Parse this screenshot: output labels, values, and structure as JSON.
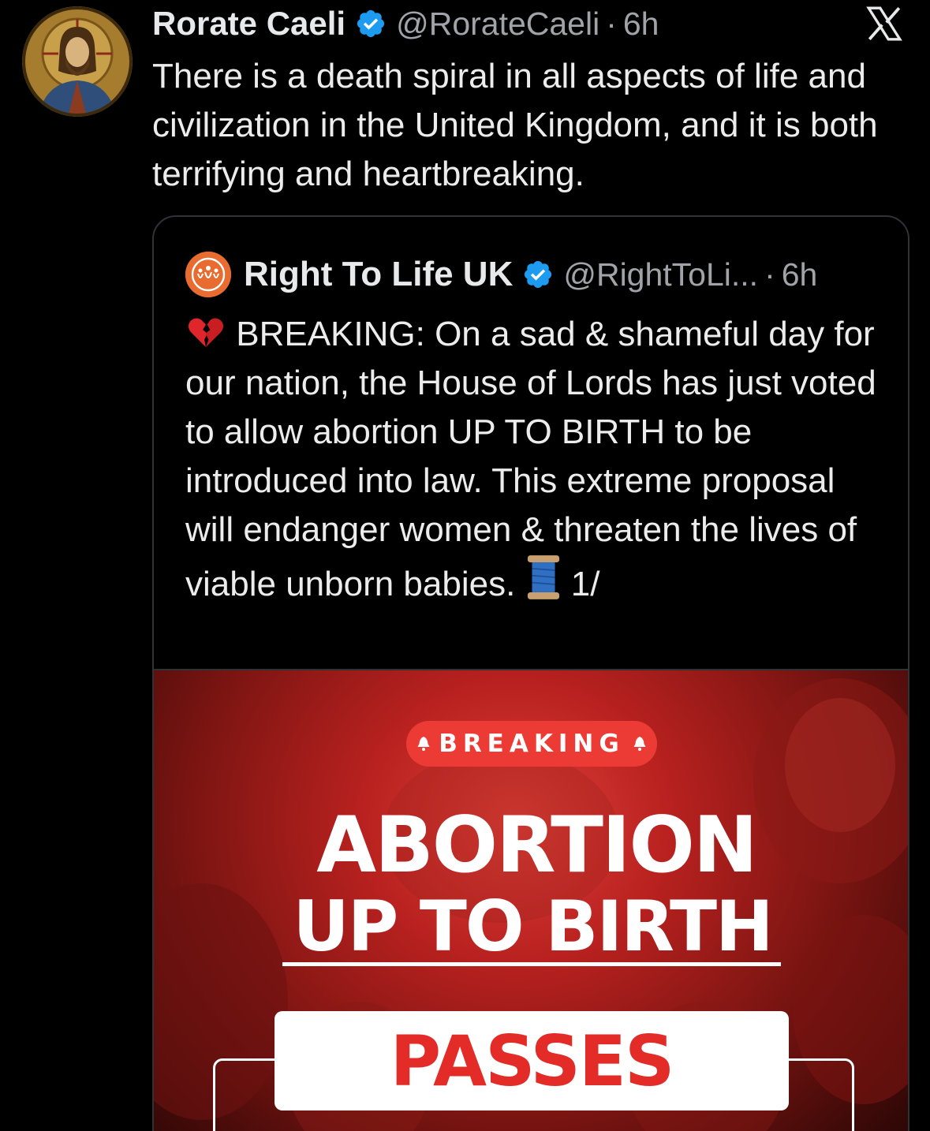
{
  "tweet": {
    "author_name": "Rorate Caeli",
    "handle": "@RorateCaeli",
    "separator": "·",
    "time": "6h",
    "text": "There is a death spiral in all aspects of life and civilization in the United Kingdom, and it is both terrifying and heartbreaking.",
    "avatar_icon": "icon-of-christ-pantocrator",
    "verified_icon": "verified-badge-icon",
    "platform_icon": "x-logo-icon"
  },
  "quote": {
    "author_name": "Right To Life UK",
    "handle": "@RightToLi...",
    "separator": "·",
    "time": "6h",
    "emoji_lead": "💔",
    "text": "BREAKING: On a sad & shameful day for our nation, the House of Lords has just voted to allow abortion UP TO BIRTH to be introduced into law. This extreme proposal will endanger women & threaten the lives of viable unborn babies.",
    "emoji_trail": "🧵",
    "thread_marker": "1/",
    "avatar_icon": "right-to-life-logo-icon",
    "verified_icon": "verified-badge-icon"
  },
  "media": {
    "pill_label": "BREAKING",
    "headline_line1": "ABORTION",
    "headline_line2": "UP TO BIRTH",
    "box_label": "PASSES"
  },
  "colors": {
    "background": "#000000",
    "text_primary": "#e7e9ea",
    "text_secondary": "#a0a4a8",
    "verified_blue": "#1d9bf0",
    "card_border": "#2f3336",
    "brand_orange": "#e86b2f",
    "media_red": "#b8211f",
    "pill_red": "#ec3a34",
    "passes_red": "#e32b27"
  }
}
